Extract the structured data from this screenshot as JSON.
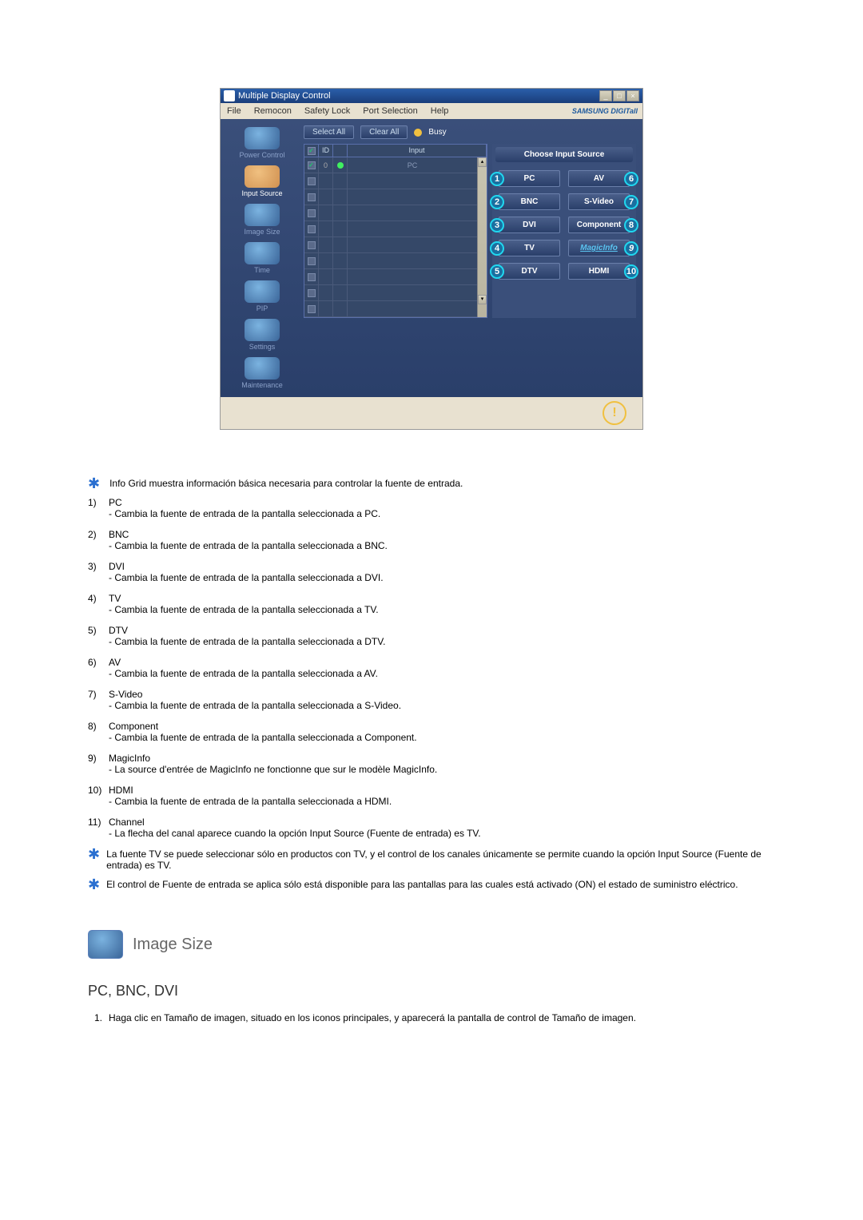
{
  "app": {
    "title": "Multiple Display Control",
    "brand": "SAMSUNG DIGITall"
  },
  "menu": [
    "File",
    "Remocon",
    "Safety Lock",
    "Port Selection",
    "Help"
  ],
  "sidebar": [
    {
      "label": "Power Control"
    },
    {
      "label": "Input Source"
    },
    {
      "label": "Image Size"
    },
    {
      "label": "Time"
    },
    {
      "label": "PIP"
    },
    {
      "label": "Settings"
    },
    {
      "label": "Maintenance"
    }
  ],
  "toolbar": {
    "select_all": "Select All",
    "clear_all": "Clear All",
    "busy": "Busy"
  },
  "grid": {
    "headers": {
      "id": "ID",
      "input": "Input"
    },
    "row_input": "PC",
    "row_id": "0"
  },
  "panel": {
    "title": "Choose Input Source",
    "sources": [
      {
        "n": "1",
        "label": "PC",
        "side": "left"
      },
      {
        "n": "6",
        "label": "AV",
        "side": "right"
      },
      {
        "n": "2",
        "label": "BNC",
        "side": "left"
      },
      {
        "n": "7",
        "label": "S-Video",
        "side": "right"
      },
      {
        "n": "3",
        "label": "DVI",
        "side": "left"
      },
      {
        "n": "8",
        "label": "Component",
        "side": "right"
      },
      {
        "n": "4",
        "label": "TV",
        "side": "left"
      },
      {
        "n": "9",
        "label": "MagicInfo",
        "side": "right",
        "magic": true
      },
      {
        "n": "5",
        "label": "DTV",
        "side": "left"
      },
      {
        "n": "10",
        "label": "HDMI",
        "side": "right"
      }
    ]
  },
  "intro": "Info Grid muestra información básica necesaria para controlar la fuente de entrada.",
  "items": [
    {
      "n": "1)",
      "name": "PC",
      "desc": "- Cambia la fuente de entrada de la pantalla seleccionada a PC."
    },
    {
      "n": "2)",
      "name": "BNC",
      "desc": "- Cambia la fuente de entrada de la pantalla seleccionada a BNC."
    },
    {
      "n": "3)",
      "name": "DVI",
      "desc": "- Cambia la fuente de entrada de la pantalla seleccionada a DVI."
    },
    {
      "n": "4)",
      "name": "TV",
      "desc": "- Cambia la fuente de entrada de la pantalla seleccionada a TV."
    },
    {
      "n": "5)",
      "name": "DTV",
      "desc": "- Cambia la fuente de entrada de la pantalla seleccionada a DTV."
    },
    {
      "n": "6)",
      "name": "AV",
      "desc": "- Cambia la fuente de entrada de la pantalla seleccionada a AV."
    },
    {
      "n": "7)",
      "name": "S-Video",
      "desc": "- Cambia la fuente de entrada de la pantalla seleccionada a S-Video."
    },
    {
      "n": "8)",
      "name": "Component",
      "desc": "- Cambia la fuente de entrada de la pantalla seleccionada a Component."
    },
    {
      "n": "9)",
      "name": "MagicInfo",
      "desc": "- La source d'entrée de MagicInfo ne fonctionne que sur le modèle MagicInfo."
    },
    {
      "n": "10)",
      "name": "HDMI",
      "desc": "- Cambia la fuente de entrada de la pantalla seleccionada a HDMI."
    },
    {
      "n": "11)",
      "name": "Channel",
      "desc": "- La flecha del canal aparece cuando la opción Input Source (Fuente de entrada) es TV."
    }
  ],
  "notes": [
    "La fuente TV se puede seleccionar sólo en productos con TV, y el control de los canales únicamente se permite cuando la opción Input Source (Fuente de entrada) es TV.",
    "El control de Fuente de entrada se aplica sólo está disponible para las pantallas para las cuales está activado (ON) el estado de suministro eléctrico."
  ],
  "section": {
    "title": "Image Size",
    "sub": "PC, BNC, DVI",
    "instr_n": "1.",
    "instr": "Haga clic en Tamaño de imagen, situado en los iconos principales, y aparecerá la pantalla de control de Tamaño de imagen."
  }
}
